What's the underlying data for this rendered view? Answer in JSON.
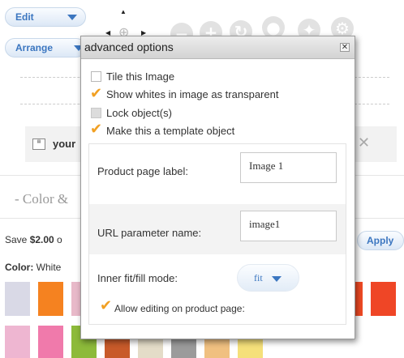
{
  "toolbar": {
    "edit_label": "Edit",
    "arrange_label": "Arrange"
  },
  "item_row": {
    "label": "your"
  },
  "section": {
    "color_heading": "- Color &"
  },
  "promo": {
    "save_prefix": "Save ",
    "save_amount": "$2.00",
    "save_suffix": " o",
    "apply_label": "Apply"
  },
  "color": {
    "label": "Color:",
    "selected_value": "White",
    "swatches_row1": [
      "#d9d9e6",
      "#f58220",
      "#e8b9c9",
      "#f5c842",
      "#f58220",
      "#f58220",
      "#ee5a24",
      "#e84d2e",
      "#f06030",
      "#e64a19",
      "#f04a24",
      "#ef4626"
    ],
    "swatches_row2": [
      "#eeb6d1",
      "#f07aab",
      "#8dba3a",
      "#c85a2a",
      "#e4dcc8",
      "#9b9b9b",
      "#f0c080",
      "#f5e07a"
    ]
  },
  "dialog": {
    "title": "advanced options",
    "close_label": "✕",
    "options": [
      {
        "label": "Tile this Image",
        "checked": false
      },
      {
        "label": "Show whites in image as transparent",
        "checked": true
      },
      {
        "label": "Lock object(s)",
        "checked": false
      },
      {
        "label": "Make this a template object",
        "checked": true
      }
    ],
    "product_page_label": {
      "label": "Product page label:",
      "value": "Image 1"
    },
    "url_parameter": {
      "label": "URL parameter name:",
      "value": "image1"
    },
    "fit_mode": {
      "label": "Inner fit/fill mode:",
      "selected": "fit"
    },
    "allow_editing": {
      "label": "Allow editing on product page:",
      "checked": true
    }
  },
  "colors": {
    "accent_blue": "#3b76c0",
    "check_orange": "#f1a023"
  }
}
